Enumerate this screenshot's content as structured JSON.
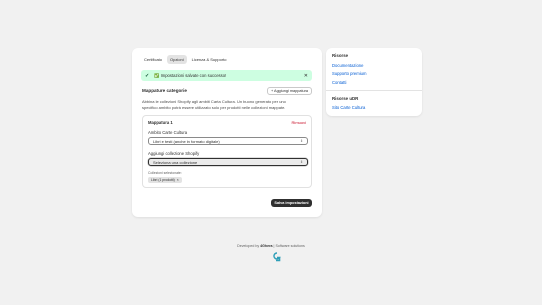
{
  "tabs": [
    "Certificato",
    "Opzioni",
    "Licenza & Supporto"
  ],
  "banner": {
    "text": "✅ Impostazioni salvate con successo!"
  },
  "section": {
    "title": "Mappature categorie",
    "add_button": "+ Aggiungi mappatura",
    "description": "Abbina le collezioni Shopify agli ambiti Carta Cultura. Un buono generato per uno specifico ambito potrà essere utilizzato solo per prodotti nelle collezioni mappate."
  },
  "mapping": {
    "title": "Mappatura 1",
    "remove": "Rimuovi",
    "ambito_label": "Ambito Carte Cultura",
    "ambito_value": "Libri e testi (anche in formato digitale)",
    "collection_label": "Aggiungi collezione Shopify",
    "collection_value": "Seleziona una collezione",
    "selected_note": "Collezioni selezionate:",
    "tag": "Libri (1 prodotti)",
    "tag_close": "×"
  },
  "save_button": "Salva impostazioni",
  "sidebar": {
    "resources_title": "Risorse",
    "links": [
      "Documentazione",
      "Supporto premium",
      "Contatti"
    ],
    "udr_title": "Risorse uDR",
    "udr_link": "Sito Carte Cultura"
  },
  "footer": {
    "prefix": "Developed by",
    "brand": "4Ghera",
    "suffix": "| Software solutions"
  },
  "colors": {
    "success_bg": "#cdfee1",
    "link": "#005bd3",
    "danger": "#c70a24",
    "primary": "#303030"
  }
}
